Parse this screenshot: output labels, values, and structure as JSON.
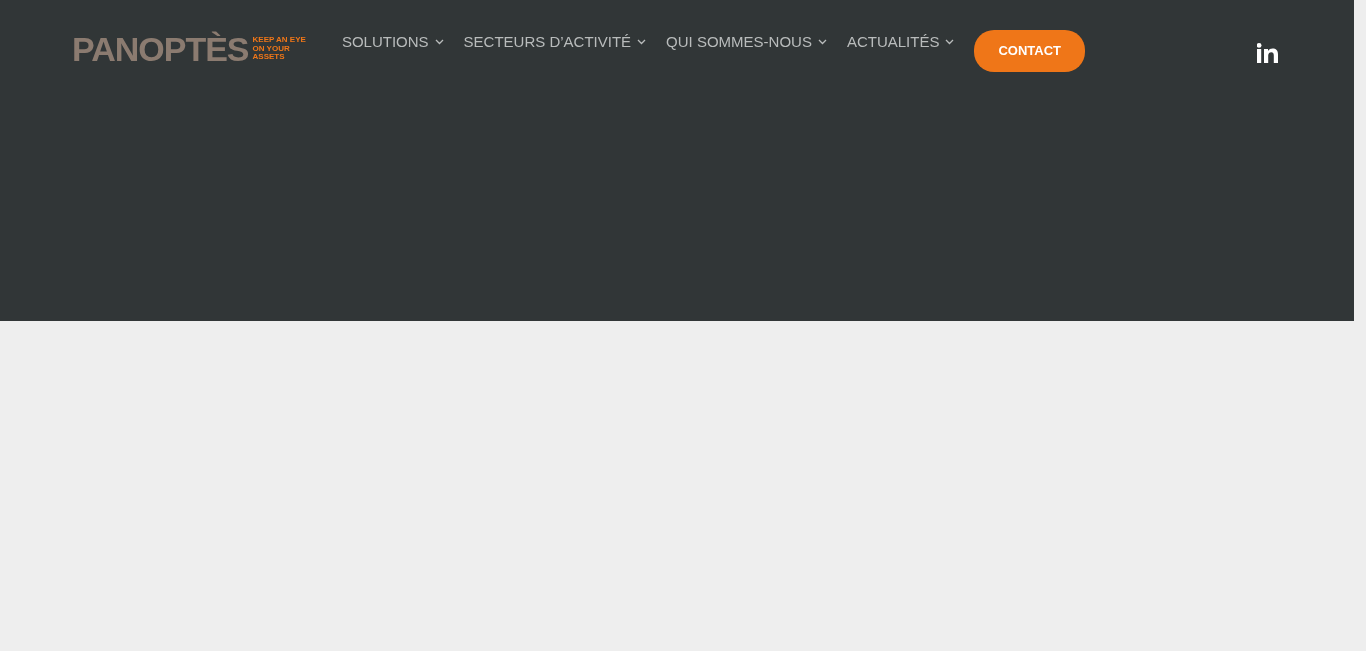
{
  "logo": {
    "name": "PANOPTÈS",
    "tagline": [
      "KEEP AN EYE",
      "ON YOUR",
      "ASSETS"
    ]
  },
  "nav": [
    {
      "label": "SOLUTIONS",
      "has_menu": true
    },
    {
      "label": "SECTEURS D’ACTIVITÉ",
      "has_menu": true
    },
    {
      "label": "QUI SOMMES-NOUS",
      "has_menu": true
    },
    {
      "label": "ACTUALITÉS",
      "has_menu": true
    }
  ],
  "cta": {
    "label": "CONTACT"
  }
}
